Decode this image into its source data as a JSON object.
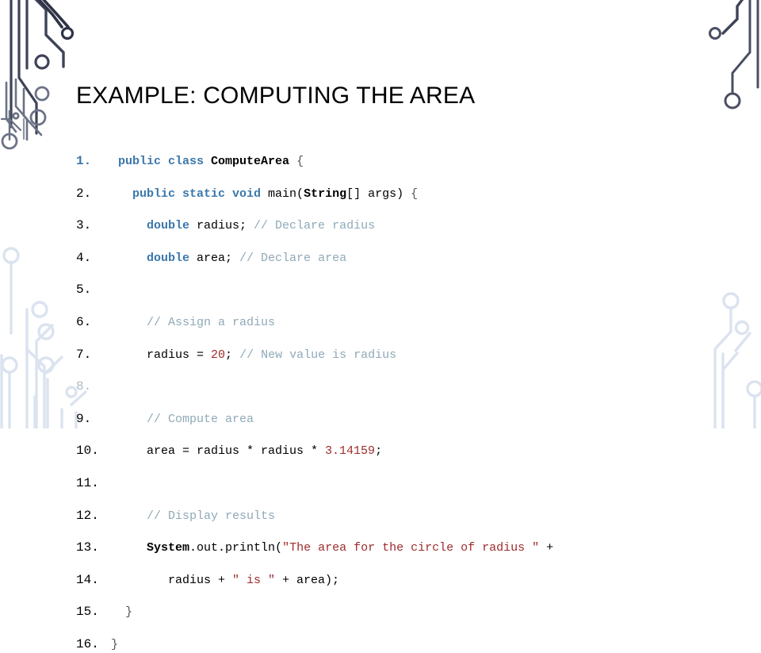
{
  "slide": {
    "title": "EXAMPLE: COMPUTING THE AREA",
    "background_color": "#ffffff"
  },
  "theme": {
    "keyword_color": "#3a77ab",
    "comment_color": "#8fa9b8",
    "string_color": "#9e2a2b",
    "number_color": "#9e2a2b",
    "plain_color": "#000000",
    "line_number_color": "#000000",
    "decoration_dark_color": "#3f4358",
    "decoration_mid_color": "#6b7285",
    "decoration_light_color": "#dbe3ef"
  },
  "code": {
    "language": "java",
    "lines": [
      {
        "number": "1.",
        "number_style": "first",
        "tokens": [
          {
            "t": " ",
            "c": "pln"
          },
          {
            "t": "public class ",
            "c": "kw"
          },
          {
            "t": "ComputeArea",
            "c": "cls"
          },
          {
            "t": " ",
            "c": "pln"
          },
          {
            "t": "{",
            "c": "brc"
          }
        ]
      },
      {
        "number": "2.",
        "number_style": "normal",
        "tokens": [
          {
            "t": "   ",
            "c": "pln"
          },
          {
            "t": "public static void ",
            "c": "kw"
          },
          {
            "t": "main(",
            "c": "pln"
          },
          {
            "t": "String",
            "c": "cls"
          },
          {
            "t": "[] args) ",
            "c": "pln"
          },
          {
            "t": "{",
            "c": "brc"
          }
        ]
      },
      {
        "number": "3.",
        "number_style": "normal",
        "tokens": [
          {
            "t": "     ",
            "c": "pln"
          },
          {
            "t": "double",
            "c": "kw"
          },
          {
            "t": " radius; ",
            "c": "pln"
          },
          {
            "t": "// Declare radius",
            "c": "cmt"
          }
        ]
      },
      {
        "number": "4.",
        "number_style": "normal",
        "tokens": [
          {
            "t": "     ",
            "c": "pln"
          },
          {
            "t": "double",
            "c": "kw"
          },
          {
            "t": " area; ",
            "c": "pln"
          },
          {
            "t": "// Declare area",
            "c": "cmt"
          }
        ]
      },
      {
        "number": "5.",
        "number_style": "normal",
        "tokens": []
      },
      {
        "number": "6.",
        "number_style": "normal",
        "tokens": [
          {
            "t": "     ",
            "c": "pln"
          },
          {
            "t": "// Assign a radius",
            "c": "cmt"
          }
        ]
      },
      {
        "number": "7.",
        "number_style": "normal",
        "tokens": [
          {
            "t": "     radius = ",
            "c": "pln"
          },
          {
            "t": "20",
            "c": "num"
          },
          {
            "t": "; ",
            "c": "pln"
          },
          {
            "t": "// New value is radius",
            "c": "cmt"
          }
        ]
      },
      {
        "number": "8.",
        "number_style": "faint",
        "tokens": []
      },
      {
        "number": "9.",
        "number_style": "normal",
        "tokens": [
          {
            "t": "     ",
            "c": "pln"
          },
          {
            "t": "// Compute area",
            "c": "cmt"
          }
        ]
      },
      {
        "number": "10.",
        "number_style": "normal",
        "tokens": [
          {
            "t": "     area = radius * radius * ",
            "c": "pln"
          },
          {
            "t": "3.14159",
            "c": "num"
          },
          {
            "t": ";",
            "c": "pln"
          }
        ]
      },
      {
        "number": "11.",
        "number_style": "normal",
        "tokens": []
      },
      {
        "number": "12.",
        "number_style": "normal",
        "tokens": [
          {
            "t": "     ",
            "c": "pln"
          },
          {
            "t": "// Display results",
            "c": "cmt"
          }
        ]
      },
      {
        "number": "13.",
        "number_style": "normal",
        "tokens": [
          {
            "t": "     ",
            "c": "pln"
          },
          {
            "t": "System",
            "c": "cls"
          },
          {
            "t": ".out.println(",
            "c": "pln"
          },
          {
            "t": "\"The area for the circle of radius \"",
            "c": "str"
          },
          {
            "t": " +",
            "c": "pln"
          }
        ]
      },
      {
        "number": "14.",
        "number_style": "normal",
        "tokens": [
          {
            "t": "        radius + ",
            "c": "pln"
          },
          {
            "t": "\" is \"",
            "c": "str"
          },
          {
            "t": " + area);",
            "c": "pln"
          }
        ]
      },
      {
        "number": "15.",
        "number_style": "normal",
        "tokens": [
          {
            "t": "  ",
            "c": "pln"
          },
          {
            "t": "}",
            "c": "brc"
          }
        ]
      },
      {
        "number": "16.",
        "number_style": "normal",
        "tokens": [
          {
            "t": "}",
            "c": "brc"
          }
        ]
      }
    ]
  },
  "decorations": {
    "top_left": "circuit-traces-dark",
    "bottom_left": "circuit-traces-light",
    "top_right": "circuit-traces-dark",
    "bottom_right": "circuit-traces-light"
  }
}
